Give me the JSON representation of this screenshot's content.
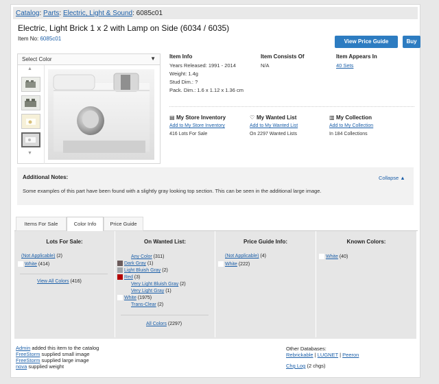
{
  "breadcrumb": {
    "catalog": "Catalog",
    "parts": "Parts",
    "category": "Electric, Light & Sound",
    "item": "6085c01"
  },
  "item": {
    "title": "Electric, Light Brick 1 x 2 with Lamp on Side (6034 / 6035)",
    "number_label": "Item No:",
    "number": "6085c01"
  },
  "buttons": {
    "price_guide": "View Price Guide",
    "buy": "Buy"
  },
  "gallery": {
    "select_color": "Select Color"
  },
  "info": {
    "heading": "Item Info",
    "years": "Years Released: 1991 - 2014",
    "weight": "Weight: 1.4g",
    "stud_dim": "Stud Dim.: ?",
    "pack_dim": "Pack. Dim.: 1.6 x 1.12 x 1.36 cm"
  },
  "consists": {
    "heading": "Item Consists Of",
    "value": "N/A"
  },
  "appears": {
    "heading": "Item Appears In",
    "link": "40 Sets"
  },
  "store": {
    "heading": "My Store Inventory",
    "link": "Add to My Store Inventory",
    "count": "416 Lots For Sale"
  },
  "wanted": {
    "heading": "My Wanted List",
    "link": "Add to My Wanted List",
    "count": "On 2297 Wanted Lists"
  },
  "collection": {
    "heading": "My Collection",
    "link": "Add to My Collection",
    "count": "In 184 Collections"
  },
  "notes": {
    "heading": "Additional Notes:",
    "collapse": "Collapse ▲",
    "text": "Some examples of this part have been found with a slightly gray looking top section. This can be seen in the additional large image."
  },
  "tabs": [
    "Items For Sale",
    "Color Info",
    "Price Guide"
  ],
  "lots": {
    "heading": "Lots For Sale:",
    "rows": [
      {
        "link": "(Not Applicable)",
        "count": " (2)"
      },
      {
        "link": "White",
        "count": " (414)"
      }
    ],
    "all": "View All Colors",
    "all_count": " (416)"
  },
  "wanted_colors": {
    "heading": "On Wanted List:",
    "rows": [
      {
        "link": "Any Color",
        "count": " (311)",
        "color": ""
      },
      {
        "link": "Dark Gray",
        "count": " (1)",
        "color": "#6b5b5b"
      },
      {
        "link": "Light Bluish Gray",
        "count": " (2)",
        "color": "#a0a5a9"
      },
      {
        "link": "Red",
        "count": " (3)",
        "color": "#b40000"
      },
      {
        "link": "Very Light Bluish Gray",
        "count": " (2)",
        "color": ""
      },
      {
        "link": "Very Light Gray",
        "count": " (1)",
        "color": ""
      },
      {
        "link": "White",
        "count": " (1975)",
        "color": "#ffffff"
      },
      {
        "link": "Trans-Clear",
        "count": " (2)",
        "color": ""
      }
    ],
    "all": "All Colors",
    "all_count": " (2297)"
  },
  "price_colors": {
    "heading": "Price Guide Info:",
    "rows": [
      {
        "link": "(Not Applicable)",
        "count": " (4)"
      },
      {
        "link": "White",
        "count": " (222)"
      }
    ]
  },
  "known_colors": {
    "heading": "Known Colors:",
    "rows": [
      {
        "link": "White",
        "count": " (40)"
      }
    ]
  },
  "footer": {
    "credits": [
      {
        "user": "Admin",
        "text": " added this item to the catalog"
      },
      {
        "user": "FreeStorm",
        "text": " supplied small image"
      },
      {
        "user": "FreeStorm",
        "text": " supplied large image"
      },
      {
        "user": "nova",
        "text": " supplied weight"
      }
    ],
    "other_db_label": "Other Databases:",
    "db_links": [
      "Rebrickable",
      "LUGNET",
      "Peeron"
    ],
    "chglog": "Chg Log",
    "chglog_count": " (2 chgs)"
  }
}
